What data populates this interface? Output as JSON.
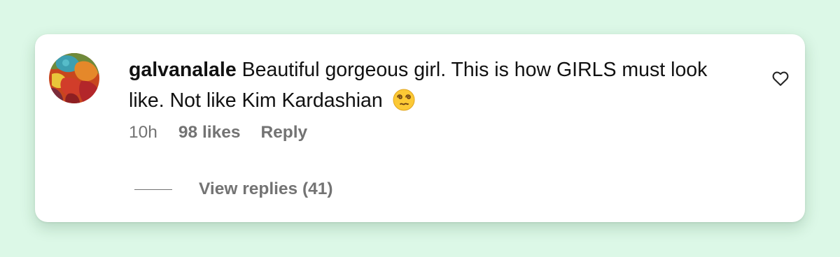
{
  "comment": {
    "username": "galvanalale",
    "text": "Beautiful gorgeous girl. This is how GIRLS must look like. Not like Kim Kardashian",
    "emoji": "face-with-spiral-eyes",
    "time": "10h",
    "likes": "98 likes",
    "reply_label": "Reply",
    "view_replies": "View replies (41)"
  },
  "icons": {
    "like": "heart-outline-icon"
  },
  "colors": {
    "background": "#dcf8e7",
    "card": "#ffffff",
    "text": "#111111",
    "secondary": "#737373"
  }
}
